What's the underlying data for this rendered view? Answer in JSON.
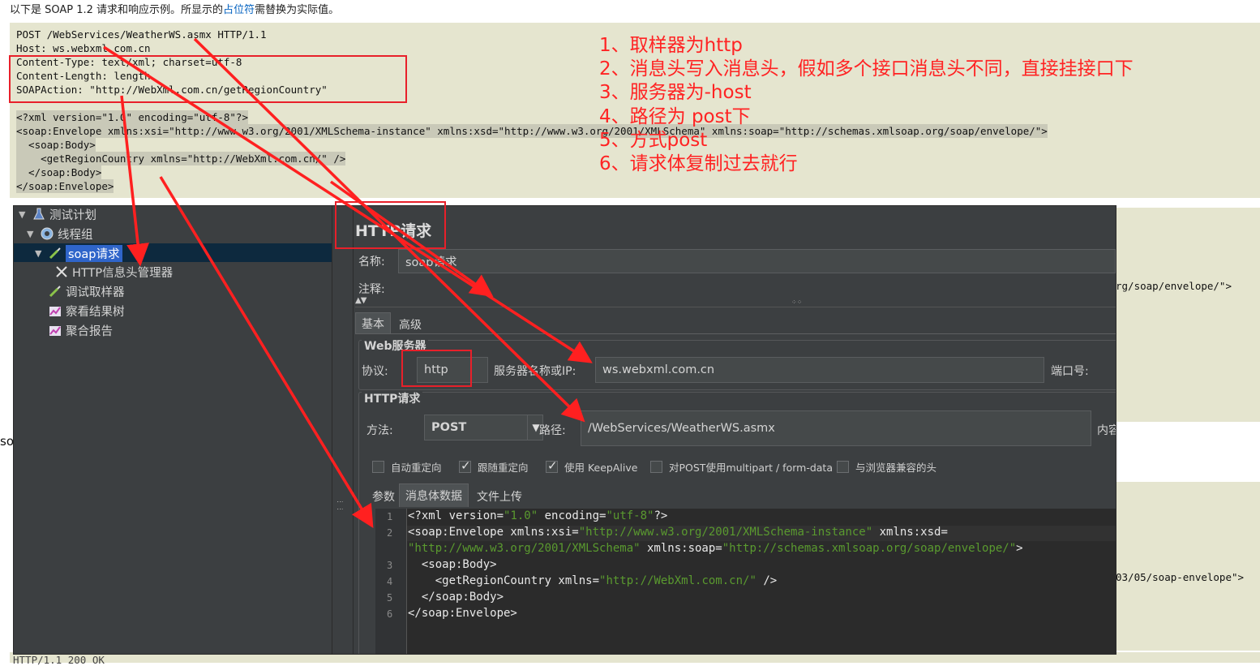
{
  "doc": {
    "intro_prefix": "以下是 SOAP 1.2 请求和响应示例。所显示的",
    "intro_link": "占位符",
    "intro_suffix": "需替换为实际值。",
    "request_lines": [
      "POST /WebServices/WeatherWS.asmx HTTP/1.1",
      "Host: ws.webxml.com.cn",
      "Content-Type: text/xml; charset=utf-8",
      "Content-Length: length",
      "SOAPAction: \"http://WebXml.com.cn/getRegionCountry\"",
      "",
      "<?xml version=\"1.0\" encoding=\"utf-8\"?>",
      "<soap:Envelope xmlns:xsi=\"http://www.w3.org/2001/XMLSchema-instance\" xmlns:xsd=\"http://www.w3.org/2001/XMLSchema\" xmlns:soap=\"http://schemas.xmlsoap.org/soap/envelope/\">",
      "  <soap:Body>",
      "    <getRegionCountry xmlns=\"http://WebXml.com.cn/\" />",
      "  </soap:Body>",
      "</soap:Envelope>"
    ],
    "fragment_envelope_1": "rg/soap/envelope/\">",
    "fragment_envelope_2": "03/05/soap-envelope\">",
    "fragment_so": "so",
    "fragment_status": "HTTP/1.1 200 OK"
  },
  "annotations": [
    "1、取样器为http",
    "2、消息头写入消息头，假如多个接口消息头不同，直接挂接口下",
    "3、服务器为-host",
    "4、路径为 post下",
    "5、方式post",
    "6、请求体复制过去就行"
  ],
  "tree": {
    "items": [
      {
        "label": "测试计划",
        "icon": "flask-icon"
      },
      {
        "label": "线程组",
        "icon": "gear-icon"
      },
      {
        "label": "soap请求",
        "icon": "pipette-icon"
      },
      {
        "label": "HTTP信息头管理器",
        "icon": "tools-icon"
      },
      {
        "label": "调试取样器",
        "icon": "pipette-icon"
      },
      {
        "label": "察看结果树",
        "icon": "chart-icon"
      },
      {
        "label": "聚合报告",
        "icon": "chart-icon"
      }
    ]
  },
  "editor": {
    "title": "HTTP请求",
    "name_label": "名称:",
    "name_value": "soap请求",
    "comment_label": "注释:",
    "tabs": [
      "基本",
      "高级"
    ],
    "web_server_title": "Web服务器",
    "protocol_label": "协议:",
    "protocol_value": "http",
    "server_label": "服务器名称或IP:",
    "server_value": "ws.webxml.com.cn",
    "port_label": "端口号:",
    "http_request_title": "HTTP请求",
    "method_label": "方法:",
    "method_value": "POST",
    "path_label": "路径:",
    "path_value": "/WebServices/WeatherWS.asmx",
    "content_encoding_label": "内容",
    "checkboxes": [
      {
        "label": "自动重定向",
        "checked": false
      },
      {
        "label": "跟随重定向",
        "checked": true
      },
      {
        "label": "使用 KeepAlive",
        "checked": true
      },
      {
        "label": "对POST使用multipart / form-data",
        "checked": false
      },
      {
        "label": "与浏览器兼容的头",
        "checked": false
      }
    ],
    "subtabs": [
      "参数",
      "消息体数据",
      "文件上传"
    ],
    "body_line_numbers": [
      "1",
      "2",
      "3",
      "4",
      "5",
      "6"
    ]
  }
}
